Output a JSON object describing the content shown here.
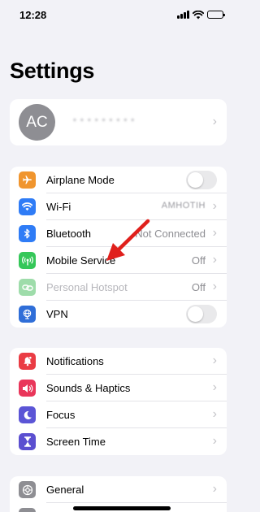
{
  "status_bar": {
    "time": "12:28",
    "battery_level": 1.0
  },
  "page_title": "Settings",
  "profile": {
    "initials": "AC",
    "name": "• • • • • • • • •"
  },
  "group1": {
    "airplane_label": "Airplane Mode",
    "airplane_on": false,
    "wifi_label": "Wi-Fi",
    "wifi_value": "AMHOTIH",
    "bluetooth_label": "Bluetooth",
    "bluetooth_value": "Not Connected",
    "mobile_label": "Mobile Service",
    "mobile_value": "Off",
    "hotspot_label": "Personal Hotspot",
    "hotspot_value": "Off",
    "vpn_label": "VPN",
    "vpn_on": false
  },
  "group2": {
    "notifications_label": "Notifications",
    "sounds_label": "Sounds & Haptics",
    "focus_label": "Focus",
    "screentime_label": "Screen Time"
  },
  "group3": {
    "general_label": "General"
  },
  "colors": {
    "airplane": "#f0952e",
    "wifi": "#2f7cf6",
    "bluetooth": "#2f7cf6",
    "mobile": "#35c759",
    "hotspot": "#9edcaa",
    "vpn": "#2f6ed8",
    "notifications": "#ea3c44",
    "sounds": "#e9365a",
    "focus": "#5b55d6",
    "screentime": "#5b4fd0",
    "general": "#8e8e93",
    "annotation_arrow": "#e0201c"
  },
  "chevron_glyph": "›"
}
